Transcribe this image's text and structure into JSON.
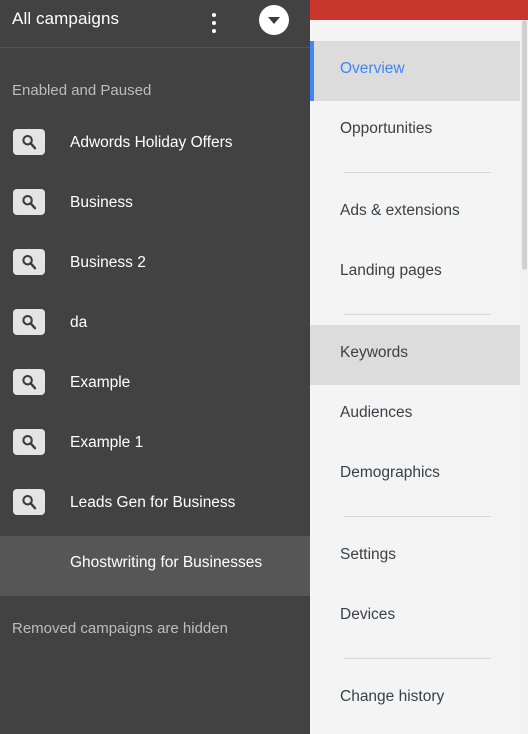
{
  "campaign_panel": {
    "header": {
      "title": "All campaigns",
      "menu_icon": "kebab-menu-icon",
      "toggle_icon": "chevron-down-icon"
    },
    "filter_note": "Enabled and Paused",
    "removed_note": "Removed campaigns are hidden",
    "item_icon": "search-icon",
    "items": [
      {
        "label": "Adwords Holiday Offers",
        "has_icon": true,
        "selected": false
      },
      {
        "label": "Business",
        "has_icon": true,
        "selected": false
      },
      {
        "label": "Business 2",
        "has_icon": true,
        "selected": false
      },
      {
        "label": "da",
        "has_icon": true,
        "selected": false
      },
      {
        "label": "Example",
        "has_icon": true,
        "selected": false
      },
      {
        "label": "Example 1",
        "has_icon": true,
        "selected": false
      },
      {
        "label": "Leads Gen for Business",
        "has_icon": true,
        "selected": false
      },
      {
        "label": "Ghostwriting for Businesses",
        "has_icon": false,
        "selected": true
      }
    ],
    "colors": {
      "background": "#424242",
      "selected_row": "#565656",
      "text": "#ffffff",
      "muted_text": "#bdbdbd",
      "chip": "#e4e4e4"
    }
  },
  "nav_panel": {
    "top_bar_color": "#c9372c",
    "accent_color": "#4285f4",
    "items": [
      {
        "label": "Overview",
        "type": "item",
        "state": "active"
      },
      {
        "label": "Opportunities",
        "type": "item",
        "state": "normal"
      },
      {
        "label": "",
        "type": "divider",
        "state": "none"
      },
      {
        "label": "Ads & extensions",
        "type": "item",
        "state": "normal"
      },
      {
        "label": "Landing pages",
        "type": "item",
        "state": "normal"
      },
      {
        "label": "",
        "type": "divider",
        "state": "none"
      },
      {
        "label": "Keywords",
        "type": "item",
        "state": "hovered"
      },
      {
        "label": "Audiences",
        "type": "item",
        "state": "normal"
      },
      {
        "label": "Demographics",
        "type": "item",
        "state": "normal"
      },
      {
        "label": "",
        "type": "divider",
        "state": "none"
      },
      {
        "label": "Settings",
        "type": "item",
        "state": "normal"
      },
      {
        "label": "Devices",
        "type": "item",
        "state": "normal"
      },
      {
        "label": "",
        "type": "divider",
        "state": "none"
      },
      {
        "label": "Change history",
        "type": "item",
        "state": "normal"
      }
    ]
  }
}
